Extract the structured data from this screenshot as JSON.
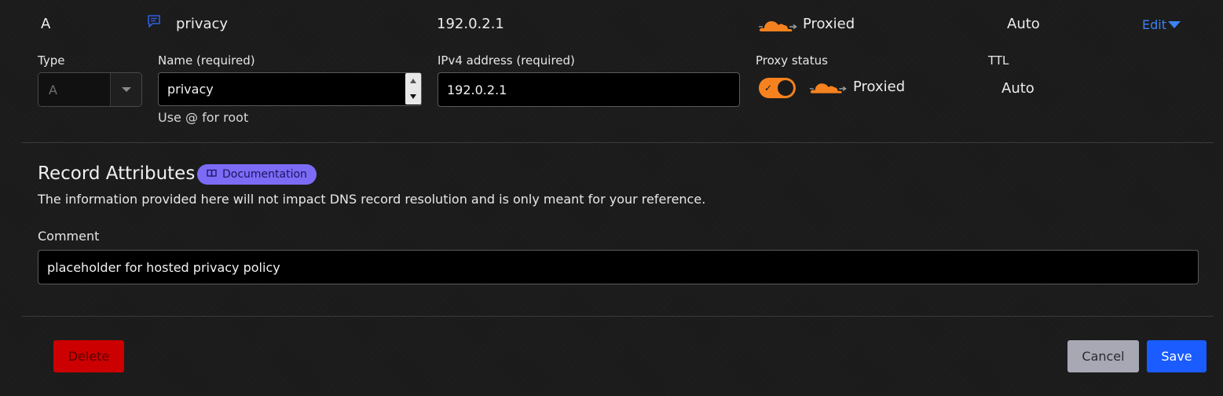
{
  "record": {
    "type": "A",
    "name": "privacy",
    "content": "192.0.2.1",
    "proxy_status": "Proxied",
    "ttl": "Auto",
    "edit_label": "Edit"
  },
  "form": {
    "type_label": "Type",
    "type_value": "A",
    "name_label": "Name (required)",
    "name_value": "privacy",
    "name_hint": "Use @ for root",
    "ipv4_label": "IPv4 address (required)",
    "ipv4_value": "192.0.2.1",
    "proxy_label": "Proxy status",
    "proxy_value": "Proxied",
    "ttl_label": "TTL",
    "ttl_value": "Auto"
  },
  "attributes": {
    "heading": "Record Attributes",
    "doc_badge": "Documentation",
    "description": "The information provided here will not impact DNS record resolution and is only meant for your reference.",
    "comment_label": "Comment",
    "comment_value": "placeholder for hosted privacy policy"
  },
  "actions": {
    "delete_label": "Delete",
    "cancel_label": "Cancel",
    "save_label": "Save"
  },
  "colors": {
    "accent_blue": "#1a5cff",
    "cloud_orange": "#f6821f",
    "delete_red": "#cc0000",
    "badge_purple": "#7c6cf5",
    "cancel_gray": "#a8a8b4"
  },
  "icons": {
    "comment": "comment-icon",
    "cloud": "cloud-icon",
    "book": "book-icon"
  }
}
